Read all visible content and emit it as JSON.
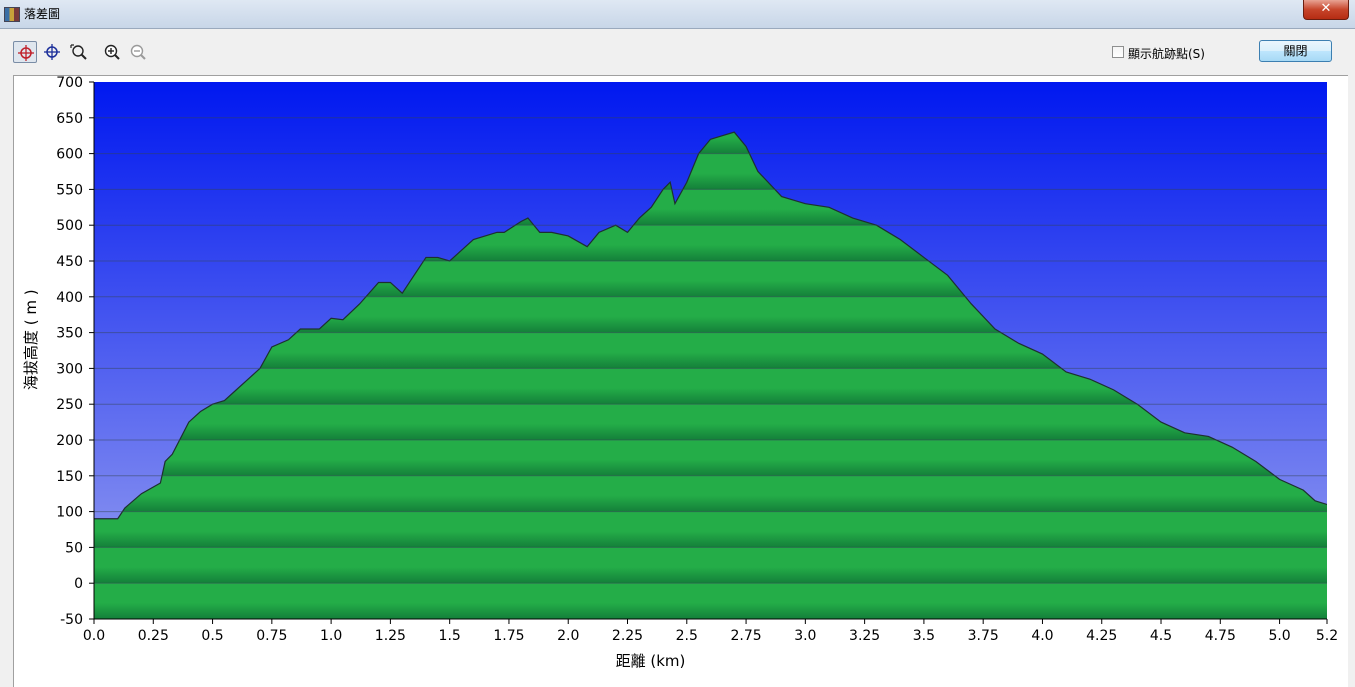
{
  "window": {
    "title": "落差圖",
    "close_label": "✕"
  },
  "toolbar": {
    "tools": [
      {
        "name": "crosshair-red-icon",
        "active": true
      },
      {
        "name": "crosshair-blue-icon",
        "active": false
      },
      {
        "name": "zoom-box-icon",
        "active": false
      },
      {
        "name": "zoom-in-icon",
        "active": false
      },
      {
        "name": "zoom-out-icon",
        "active": false
      }
    ],
    "show_track_points_label": "顯示航跡點(S)",
    "show_track_points_checked": false,
    "close_button_label": "關閉"
  },
  "colors": {
    "sky_top": "#0018f0",
    "sky_bottom": "#9aa2f0",
    "terrain_light": "#24ad48",
    "terrain_dark": "#14803a",
    "profile_line": "#1e3030",
    "grid_line": "#334455"
  },
  "chart_data": {
    "type": "area",
    "xlabel": "距離 (km)",
    "ylabel": "海拔高度 ( m )",
    "xlim": [
      0,
      5.2
    ],
    "ylim": [
      -50,
      700
    ],
    "x_ticks": [
      0,
      0.25,
      0.5,
      0.75,
      1.0,
      1.25,
      1.5,
      1.75,
      2.0,
      2.25,
      2.5,
      2.75,
      3.0,
      3.25,
      3.5,
      3.75,
      4.0,
      4.25,
      4.5,
      4.75,
      5.0,
      5.2
    ],
    "x_tick_labels": [
      "0.0",
      "0.25",
      "0.5",
      "0.75",
      "1.0",
      "1.25",
      "1.5",
      "1.75",
      "2.0",
      "2.25",
      "2.5",
      "2.75",
      "3.0",
      "3.25",
      "3.5",
      "3.75",
      "4.0",
      "4.25",
      "4.5",
      "4.75",
      "5.0",
      "5.2"
    ],
    "y_ticks": [
      -50,
      0,
      50,
      100,
      150,
      200,
      250,
      300,
      350,
      400,
      450,
      500,
      550,
      600,
      650,
      700
    ],
    "grid": true,
    "series": [
      {
        "x": [
          0.0,
          0.02,
          0.1,
          0.13,
          0.2,
          0.28,
          0.3,
          0.33,
          0.4,
          0.45,
          0.5,
          0.55,
          0.6,
          0.7,
          0.75,
          0.82,
          0.87,
          0.95,
          1.0,
          1.05,
          1.12,
          1.2,
          1.25,
          1.3,
          1.35,
          1.4,
          1.45,
          1.5,
          1.6,
          1.7,
          1.73,
          1.8,
          1.83,
          1.88,
          1.93,
          2.0,
          2.08,
          2.13,
          2.2,
          2.25,
          2.3,
          2.35,
          2.4,
          2.43,
          2.45,
          2.5,
          2.55,
          2.6,
          2.65,
          2.7,
          2.75,
          2.8,
          2.9,
          3.0,
          3.1,
          3.2,
          3.3,
          3.4,
          3.5,
          3.6,
          3.7,
          3.8,
          3.9,
          4.0,
          4.1,
          4.2,
          4.3,
          4.4,
          4.5,
          4.6,
          4.7,
          4.8,
          4.9,
          5.0,
          5.1,
          5.15,
          5.2
        ],
        "y": [
          90,
          90,
          90,
          105,
          125,
          140,
          170,
          180,
          225,
          240,
          250,
          255,
          270,
          300,
          330,
          340,
          355,
          355,
          370,
          368,
          390,
          420,
          420,
          405,
          430,
          455,
          455,
          450,
          480,
          490,
          490,
          505,
          510,
          490,
          490,
          485,
          470,
          490,
          500,
          490,
          510,
          525,
          550,
          560,
          530,
          560,
          600,
          620,
          625,
          630,
          610,
          575,
          540,
          530,
          525,
          510,
          500,
          480,
          455,
          430,
          390,
          355,
          335,
          320,
          295,
          285,
          270,
          250,
          225,
          210,
          205,
          190,
          170,
          145,
          130,
          115,
          110
        ]
      }
    ]
  }
}
